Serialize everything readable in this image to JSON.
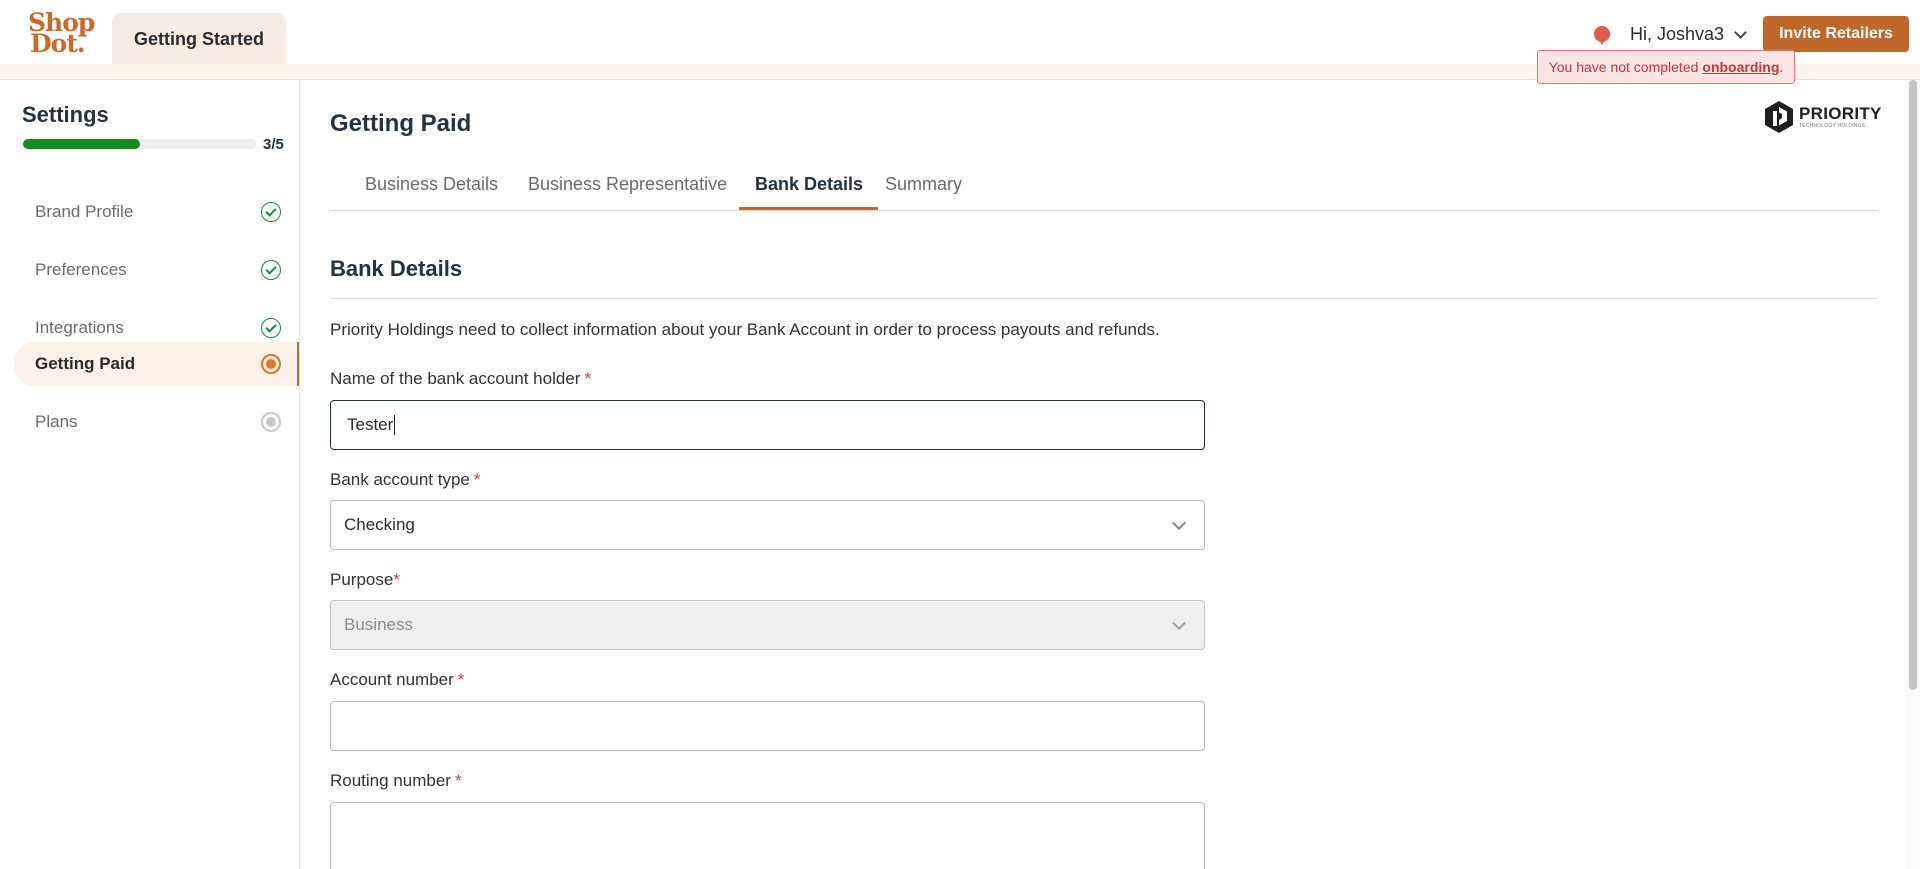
{
  "brand": {
    "logo_line1": "Shop",
    "logo_line2": "Dot.",
    "color": "#c9692e"
  },
  "header": {
    "active_tab": "Getting Started",
    "greeting": "Hi, Joshva3",
    "invite_button": "Invite Retailers",
    "alert": {
      "text": "You have not completed",
      "link": "onboarding",
      "suffix": "."
    }
  },
  "sidebar": {
    "title": "Settings",
    "progress": {
      "completed": 3,
      "total": 5,
      "label": "3/5",
      "fraction": 0.5
    },
    "items": [
      {
        "label": "Brand Profile",
        "status": "complete"
      },
      {
        "label": "Preferences",
        "status": "complete"
      },
      {
        "label": "Integrations",
        "status": "complete"
      },
      {
        "label": "Getting Paid",
        "status": "current"
      },
      {
        "label": "Plans",
        "status": "pending"
      }
    ]
  },
  "main": {
    "title": "Getting Paid",
    "partner_logo": {
      "name": "PRIORITY",
      "tagline": "TECHNOLOGY HOLDINGS"
    },
    "tabs": [
      {
        "label": "Business Details",
        "active": false
      },
      {
        "label": "Business Representative",
        "active": false
      },
      {
        "label": "Bank Details",
        "active": true
      },
      {
        "label": "Summary",
        "active": false
      }
    ],
    "section_title": "Bank Details",
    "description": "Priority Holdings need to collect information about your Bank Account in order to process payouts and refunds.",
    "fields": {
      "holder": {
        "label": "Name of the bank account holder",
        "required": "*",
        "value": "Tester"
      },
      "account_type": {
        "label": "Bank account type",
        "required": "*",
        "value": "Checking"
      },
      "purpose": {
        "label": "Purpose",
        "required": "*",
        "value": "Business",
        "disabled": true
      },
      "account_number": {
        "label": "Account number",
        "required": "*",
        "value": ""
      },
      "routing_number": {
        "label": "Routing number",
        "required": "*",
        "value": ""
      }
    }
  },
  "colors": {
    "accent": "#c0682c",
    "progress": "#138a1e",
    "complete": "#1c8a3f",
    "current": "#e27428",
    "pending": "#c8c8c8",
    "alert": "#c0393b"
  }
}
